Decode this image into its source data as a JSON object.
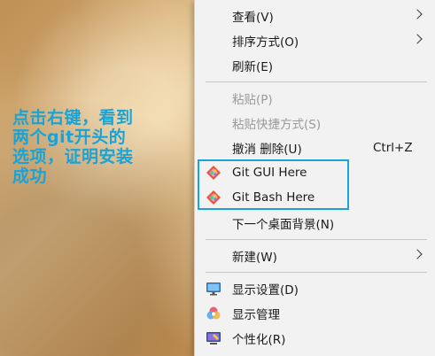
{
  "annotation": {
    "lines": [
      "点击右键，看到",
      "两个git开头的",
      "选项，证明安装",
      "成功"
    ],
    "color": "#1aa3d6"
  },
  "menu": {
    "view": "查看(V)",
    "sort": "排序方式(O)",
    "refresh": "刷新(E)",
    "paste": "粘贴(P)",
    "paste_shortcut": "粘贴快捷方式(S)",
    "undo": "撤消 删除(U)",
    "undo_shortcut": "Ctrl+Z",
    "git_gui": "Git GUI Here",
    "git_bash": "Git Bash Here",
    "next_bg": "下一个桌面背景(N)",
    "new": "新建(W)",
    "display_settings": "显示设置(D)",
    "display_manage": "显示管理",
    "personalize": "个性化(R)"
  },
  "icons": {
    "git": "git-logo-icon",
    "display": "monitor-icon",
    "display_manage": "color-wheel-icon",
    "personalize": "personalize-icon"
  },
  "highlight_color": "#1aa3d6"
}
